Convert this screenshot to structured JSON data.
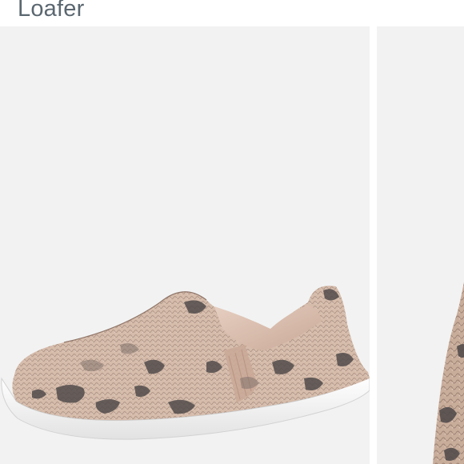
{
  "product": {
    "title": "Loafer"
  },
  "gallery": {
    "images": [
      {
        "subject": "snakeskin-slip-on-loafer"
      },
      {
        "subject": "snakeskin-slip-on-loafer-closeup"
      }
    ]
  },
  "colors": {
    "title_text": "#5b6770",
    "image_background": "#f2f2f2",
    "snakeskin_base": "#d3b9a8",
    "snakeskin_dark": "#4d4848",
    "sole": "#ffffff"
  }
}
